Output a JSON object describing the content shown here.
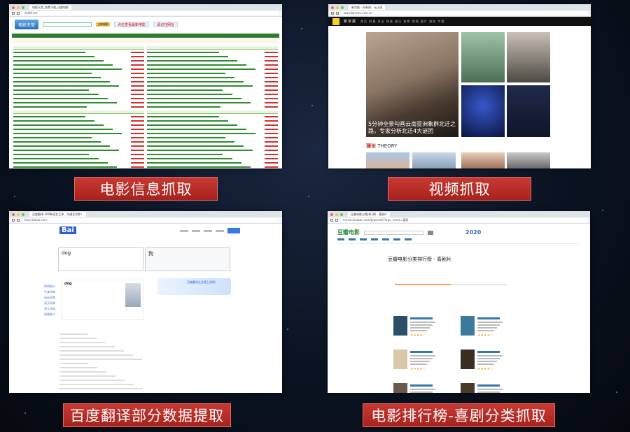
{
  "panels": {
    "movie_info": {
      "caption": "电影信息抓取",
      "tab_title": "电影天堂_免费下载_迅雷电影",
      "url": "dytt8.net",
      "logo_text": "电影天堂",
      "search_button": "立即搜索",
      "promo_text": "点击查看最新电影",
      "promo_text2": "请记住网址"
    },
    "video": {
      "caption": "视频抓取",
      "tab_title": "新京报 - 好新闻，无止境",
      "url": "www.bjnews.com.cn",
      "site_name": "新京报",
      "nav_text": "首页  时事  评论  财经  娱乐  体育  视频  图片  政务  专题",
      "headline": "5分钟全景勾画云南亚洲象群北迁之路，专家分析北迁4大谜团",
      "section_cn": "理论",
      "section_en": "THEORY"
    },
    "translate": {
      "caption": "百度翻译部分数据提取",
      "tab_title": "百度翻译-200种语言互译、沟通全世界！",
      "url": "fanyi.baidu.com",
      "logo_text": "Bai",
      "source_word": "dog",
      "target_word": "狗",
      "banner_text": "百度翻译企业版上线啦！",
      "side_items": [
        "简明释义",
        "牛津词典",
        "英英词典",
        "英汉词典",
        "同义词组",
        "网络释义"
      ]
    },
    "douban": {
      "caption": "电影排行榜-喜剧分类抓取",
      "tab_title": "豆瓣电影分类排行榜 - 喜剧片",
      "url": "movie.douban.com/typerank?type_name=喜剧",
      "logo_text": "豆瓣电影",
      "page_title": "豆瓣电影分类排行榜 - 喜剧片",
      "year_badge": "2020"
    }
  },
  "colors": {
    "caption_red": "#b32a24",
    "douban_green": "#2b8a3e",
    "baidu_blue": "#2f5dd3"
  }
}
